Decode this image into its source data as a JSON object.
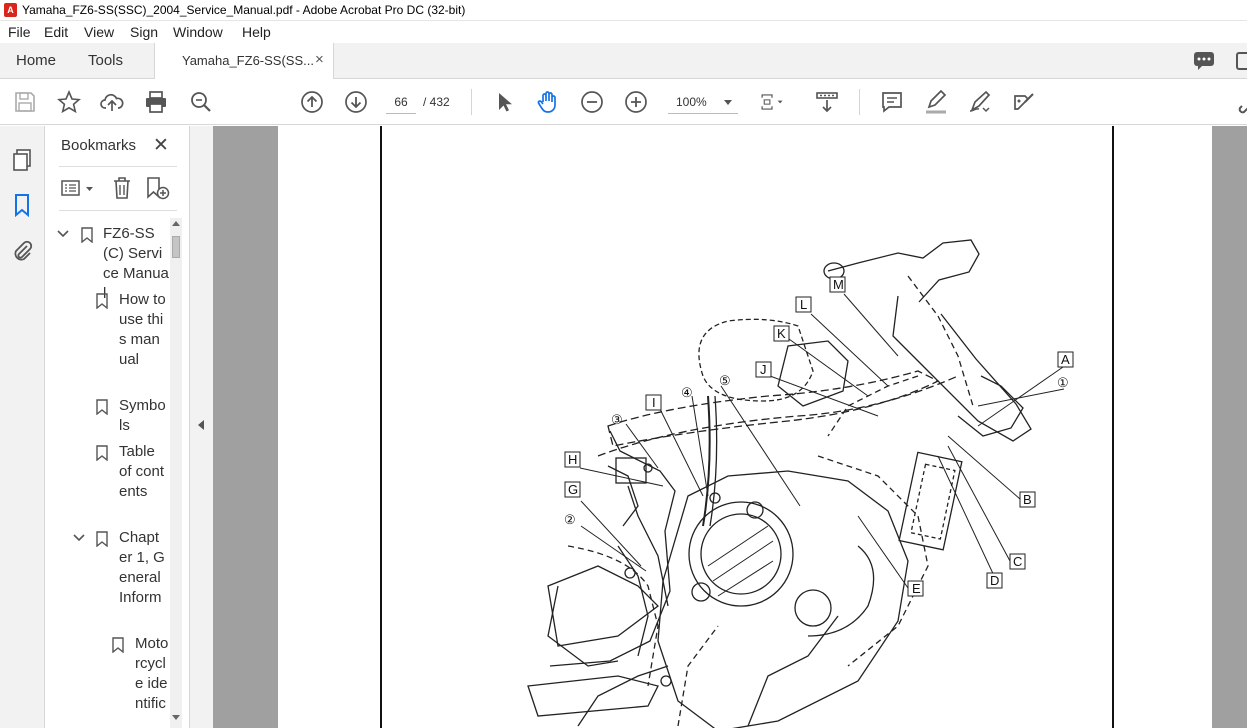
{
  "window": {
    "title": "Yamaha_FZ6-SS(SSC)_2004_Service_Manual.pdf - Adobe Acrobat Pro DC (32-bit)"
  },
  "menu": [
    "File",
    "Edit",
    "View",
    "Sign",
    "Window",
    "Help"
  ],
  "tabs": {
    "home": "Home",
    "tools": "Tools",
    "document": "Yamaha_FZ6-SS(SS...",
    "close": "×"
  },
  "toolbar": {
    "page_current": "66",
    "page_total": "/ 432",
    "zoom": "100%"
  },
  "bookmarks": {
    "title": "Bookmarks",
    "close": "✕",
    "items": [
      {
        "label": "FZ6-SS(C) Service Manual",
        "expanded": true
      },
      {
        "label": "How to use this manual"
      },
      {
        "label": "Symbols"
      },
      {
        "label": "Table of contents"
      },
      {
        "label": "Chapter 1, General Inform",
        "expanded": true
      },
      {
        "label": "Motorcycle identific"
      }
    ]
  },
  "diagram": {
    "letter_labels": [
      "M",
      "L",
      "K",
      "J",
      "I",
      "H",
      "G",
      "A",
      "B",
      "C",
      "D",
      "E"
    ],
    "number_labels": [
      "④",
      "⑤",
      "③",
      "②",
      "①"
    ]
  }
}
